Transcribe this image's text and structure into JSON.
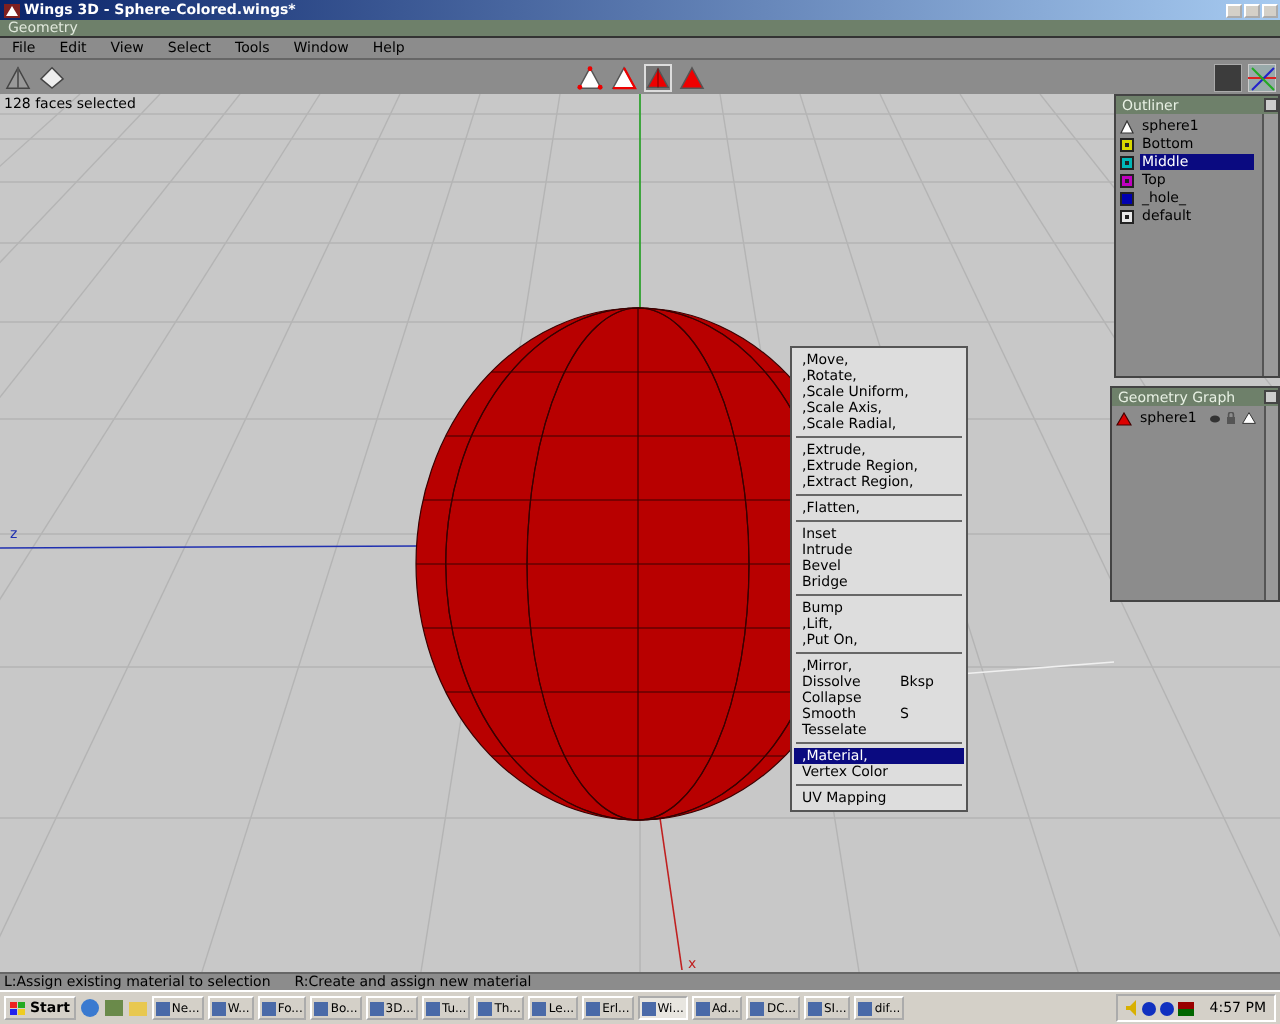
{
  "window": {
    "title": "Wings 3D - Sphere-Colored.wings*"
  },
  "geometry_bar": {
    "title": "Geometry"
  },
  "menu": [
    "File",
    "Edit",
    "View",
    "Select",
    "Tools",
    "Window",
    "Help"
  ],
  "select_modes": [
    {
      "kind": "vertex",
      "selected": false
    },
    {
      "kind": "edge",
      "selected": false
    },
    {
      "kind": "face",
      "selected": true
    },
    {
      "kind": "body",
      "selected": false
    }
  ],
  "viewport": {
    "info": "128 faces selected",
    "axis_labels": [
      {
        "kind": "z",
        "label": "z"
      },
      {
        "kind": "x",
        "label": "x"
      }
    ]
  },
  "outliner": {
    "title": "Outliner",
    "items": [
      {
        "label": "sphere1",
        "kind": "object",
        "selected": false
      },
      {
        "label": "Bottom",
        "kind": "material",
        "color": "#d8d800",
        "selected": false
      },
      {
        "label": "Middle",
        "kind": "material",
        "color": "#00b8b8",
        "selected": true
      },
      {
        "label": "Top",
        "kind": "material",
        "color": "#c000c0",
        "selected": false
      },
      {
        "label": "_hole_",
        "kind": "solid",
        "color": "#0000b0",
        "selected": false
      },
      {
        "label": "default",
        "kind": "material",
        "color": "#e8e8e8",
        "selected": false
      }
    ]
  },
  "geometry_graph": {
    "title": "Geometry Graph",
    "items": [
      {
        "label": "sphere1"
      }
    ]
  },
  "context_menu": {
    "groups": [
      [
        {
          "label": ",Move,",
          "selected": false
        },
        {
          "label": ",Rotate,",
          "selected": false
        },
        {
          "label": ",Scale Uniform,",
          "selected": false
        },
        {
          "label": ",Scale Axis,",
          "selected": false
        },
        {
          "label": ",Scale Radial,",
          "selected": false
        }
      ],
      [
        {
          "label": ",Extrude,",
          "selected": false
        },
        {
          "label": ",Extrude Region,",
          "selected": false
        },
        {
          "label": ",Extract Region,",
          "selected": false
        }
      ],
      [
        {
          "label": ",Flatten,",
          "selected": false
        }
      ],
      [
        {
          "label": "Inset",
          "selected": false
        },
        {
          "label": "Intrude",
          "selected": false
        },
        {
          "label": "Bevel",
          "selected": false
        },
        {
          "label": "Bridge",
          "selected": false
        }
      ],
      [
        {
          "label": "Bump",
          "selected": false
        },
        {
          "label": ",Lift,",
          "selected": false
        },
        {
          "label": ",Put On,",
          "selected": false
        }
      ],
      [
        {
          "label": ",Mirror,",
          "selected": false
        },
        {
          "label": "Dissolve",
          "hotkey": "Bksp",
          "selected": false
        },
        {
          "label": "Collapse",
          "selected": false
        },
        {
          "label": "Smooth",
          "hotkey": "S",
          "selected": false
        },
        {
          "label": "Tesselate",
          "selected": false
        }
      ],
      [
        {
          "label": ",Material,",
          "selected": true
        },
        {
          "label": "Vertex Color",
          "selected": false
        }
      ],
      [
        {
          "label": "UV Mapping",
          "selected": false
        }
      ]
    ]
  },
  "status_bar": {
    "left": "L:Assign existing material to selection",
    "right": "R:Create and assign new material"
  },
  "taskbar": {
    "start": "Start",
    "tasks": [
      {
        "label": "Ne...",
        "selected": false
      },
      {
        "label": "W...",
        "selected": false
      },
      {
        "label": "Fo...",
        "selected": false
      },
      {
        "label": "Bo...",
        "selected": false
      },
      {
        "label": "3D...",
        "selected": false
      },
      {
        "label": "Tu...",
        "selected": false
      },
      {
        "label": "Th...",
        "selected": false
      },
      {
        "label": "Le...",
        "selected": false
      },
      {
        "label": "Erl...",
        "selected": false
      },
      {
        "label": "Wi...",
        "selected": true
      },
      {
        "label": "Ad...",
        "selected": false
      },
      {
        "label": "DC...",
        "selected": false
      },
      {
        "label": "SI...",
        "selected": false
      },
      {
        "label": "dif...",
        "selected": false
      }
    ],
    "clock": "4:57 PM"
  }
}
